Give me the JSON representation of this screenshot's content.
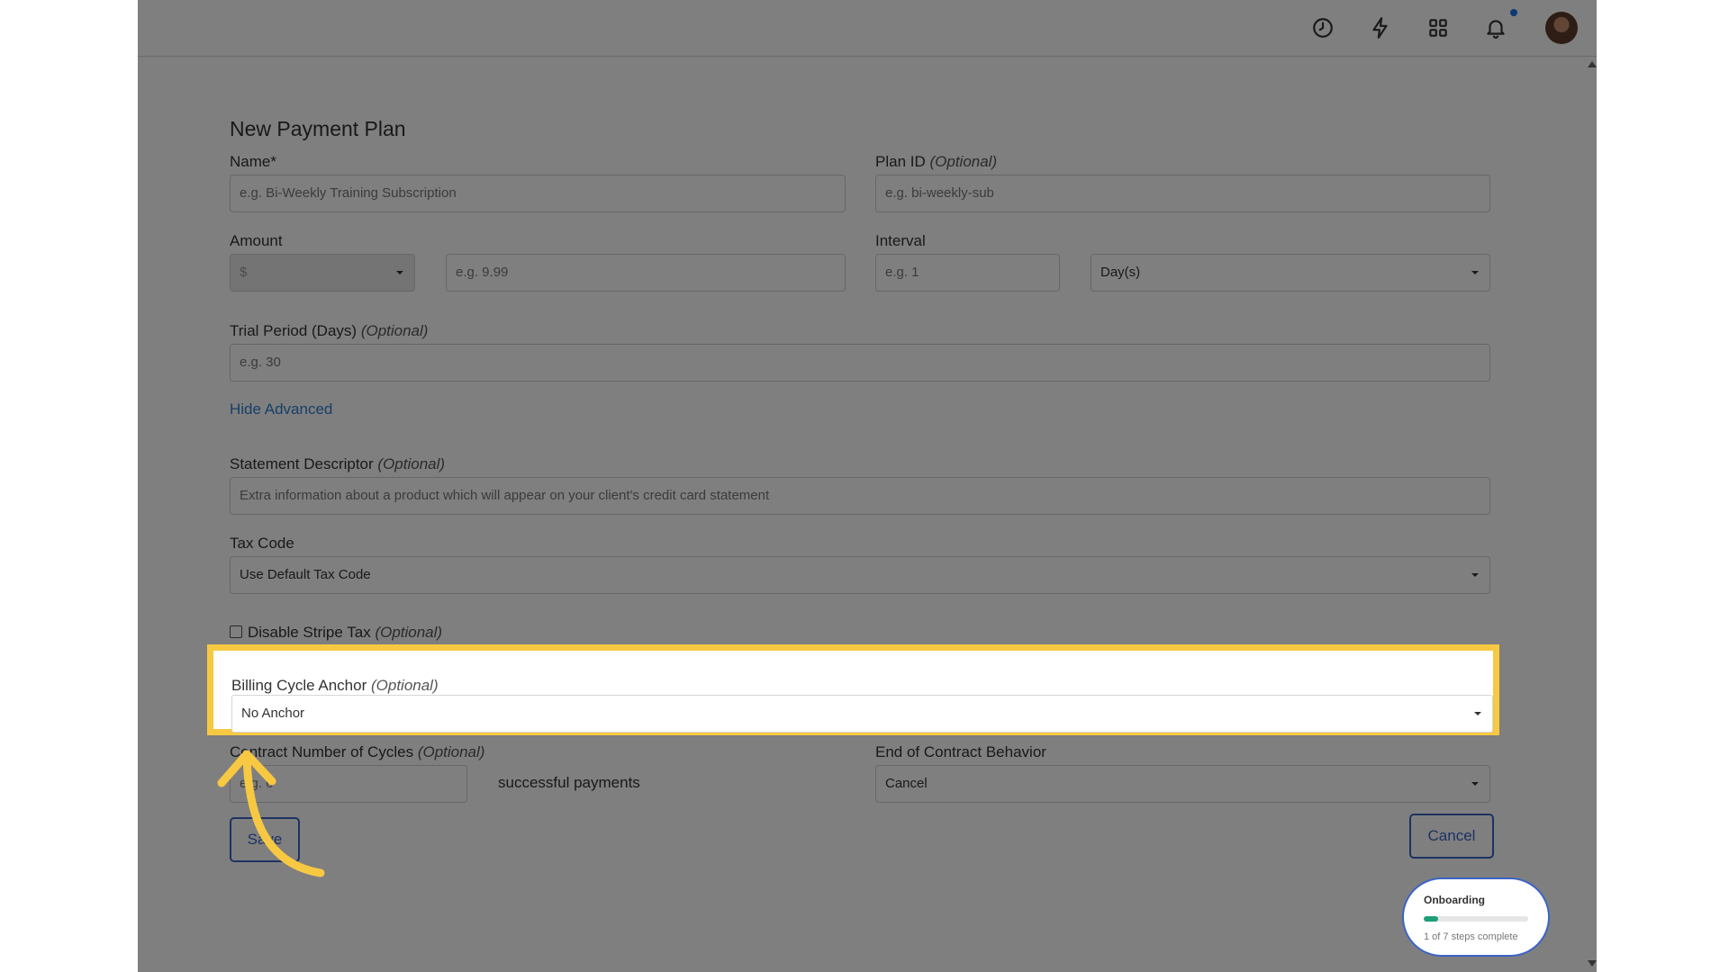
{
  "form": {
    "title": "New Payment Plan",
    "name_label": "Name*",
    "name_placeholder": "e.g. Bi-Weekly Training Subscription",
    "plan_id_label": "Plan ID",
    "plan_id_optional": "(Optional)",
    "plan_id_placeholder": "e.g. bi-weekly-sub",
    "amount_label": "Amount",
    "currency_value": "$",
    "amount_placeholder": "e.g. 9.99",
    "interval_label": "Interval",
    "interval_placeholder": "e.g. 1",
    "interval_unit_value": "Day(s)",
    "trial_label": "Trial Period (Days)",
    "trial_optional": "(Optional)",
    "trial_placeholder": "e.g. 30",
    "hide_advanced": "Hide Advanced",
    "statement_label": "Statement Descriptor",
    "statement_optional": "(Optional)",
    "statement_placeholder": "Extra information about a product which will appear on your client's credit card statement",
    "tax_code_label": "Tax Code",
    "tax_code_value": "Use Default Tax Code",
    "disable_tax_label": "Disable Stripe Tax",
    "disable_tax_optional": "(Optional)",
    "billing_anchor_label": "Billing Cycle Anchor",
    "billing_anchor_optional": "(Optional)",
    "billing_anchor_value": "No Anchor",
    "contract_cycles_label": "Contract Number of Cycles",
    "contract_cycles_optional": "(Optional)",
    "contract_cycles_placeholder": "e.g. 6",
    "successful_payments": "successful payments",
    "end_contract_label": "End of Contract Behavior",
    "end_contract_value": "Cancel",
    "save_label": "Save",
    "cancel_label": "Cancel"
  },
  "onboarding": {
    "title": "Onboarding",
    "progress_text": "1 of 7 steps complete",
    "progress_fraction": 0.14
  },
  "colors": {
    "highlight": "#f7c842",
    "link": "#2f7dd1",
    "button": "#3b64c5"
  },
  "icons": [
    "clock-icon",
    "lightning-icon",
    "grid-icon",
    "bell-icon"
  ]
}
